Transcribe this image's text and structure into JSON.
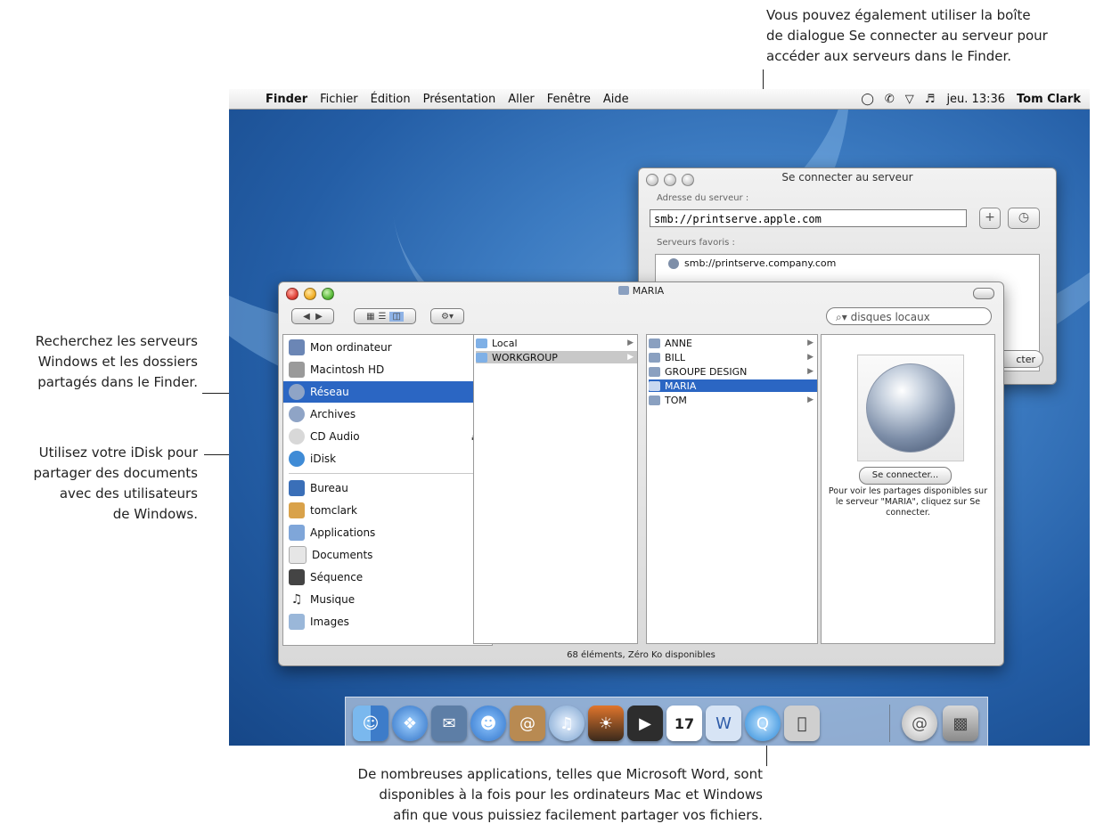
{
  "callouts": {
    "top": [
      "Vous pouvez également utiliser la boîte",
      "de dialogue Se connecter au serveur pour",
      "accéder aux serveurs dans le Finder."
    ],
    "left1": [
      "Recherchez les serveurs",
      "Windows et les dossiers",
      "partagés dans le Finder."
    ],
    "left2": [
      "Utilisez votre iDisk pour",
      "partager des documents",
      "avec des utilisateurs",
      "de Windows."
    ],
    "bottom": [
      "De nombreuses applications, telles que Microsoft Word, sont",
      "disponibles à la fois pour les ordinateurs Mac et Windows",
      "afin que vous puissiez facilement partager vos fichiers."
    ]
  },
  "menubar": {
    "app": "Finder",
    "items": [
      "Fichier",
      "Édition",
      "Présentation",
      "Aller",
      "Fenêtre",
      "Aide"
    ],
    "status_icons": [
      "chat-icon",
      "phone-icon",
      "wifi-icon",
      "volume-icon"
    ],
    "clock": "jeu. 13:36",
    "user": "Tom Clark"
  },
  "connect_dialog": {
    "title": "Se connecter au serveur",
    "address_label": "Adresse du serveur :",
    "address_value": "smb://printserve.apple.com",
    "add_button": "+",
    "favorites_label": "Serveurs favoris :",
    "favorites": [
      "smb://printserve.company.com"
    ],
    "connect_button": "cter"
  },
  "finder": {
    "title": "MARIA",
    "search_placeholder": "disques locaux",
    "sidebar_devices": [
      "Mon ordinateur",
      "Macintosh HD",
      "Réseau",
      "Archives",
      "CD Audio",
      "iDisk"
    ],
    "sidebar_places": [
      "Bureau",
      "tomclark",
      "Applications",
      "Documents",
      "Séquence",
      "Musique",
      "Images"
    ],
    "selected_sidebar": "Réseau",
    "column1": [
      "Local",
      "WORKGROUP"
    ],
    "column2": [
      "ANNE",
      "BILL",
      "GROUPE DESIGN",
      "MARIA",
      "TOM"
    ],
    "selected_server": "MARIA",
    "preview_button": "Se connecter...",
    "preview_text": "Pour voir les partages disponibles sur le serveur \"MARIA\", cliquez sur Se connecter.",
    "status": "68 éléments, Zéro Ko disponibles"
  },
  "dock": {
    "apps": [
      "finder-icon",
      "safari-icon",
      "mail-icon",
      "ichat-icon",
      "address-book-icon",
      "itunes-icon",
      "iphoto-icon",
      "imovie-icon",
      "ical-icon",
      "word-icon",
      "quicktime-icon",
      "system-preferences-icon",
      "mail-stamp-icon",
      "trash-icon"
    ],
    "ical_date": "17"
  }
}
